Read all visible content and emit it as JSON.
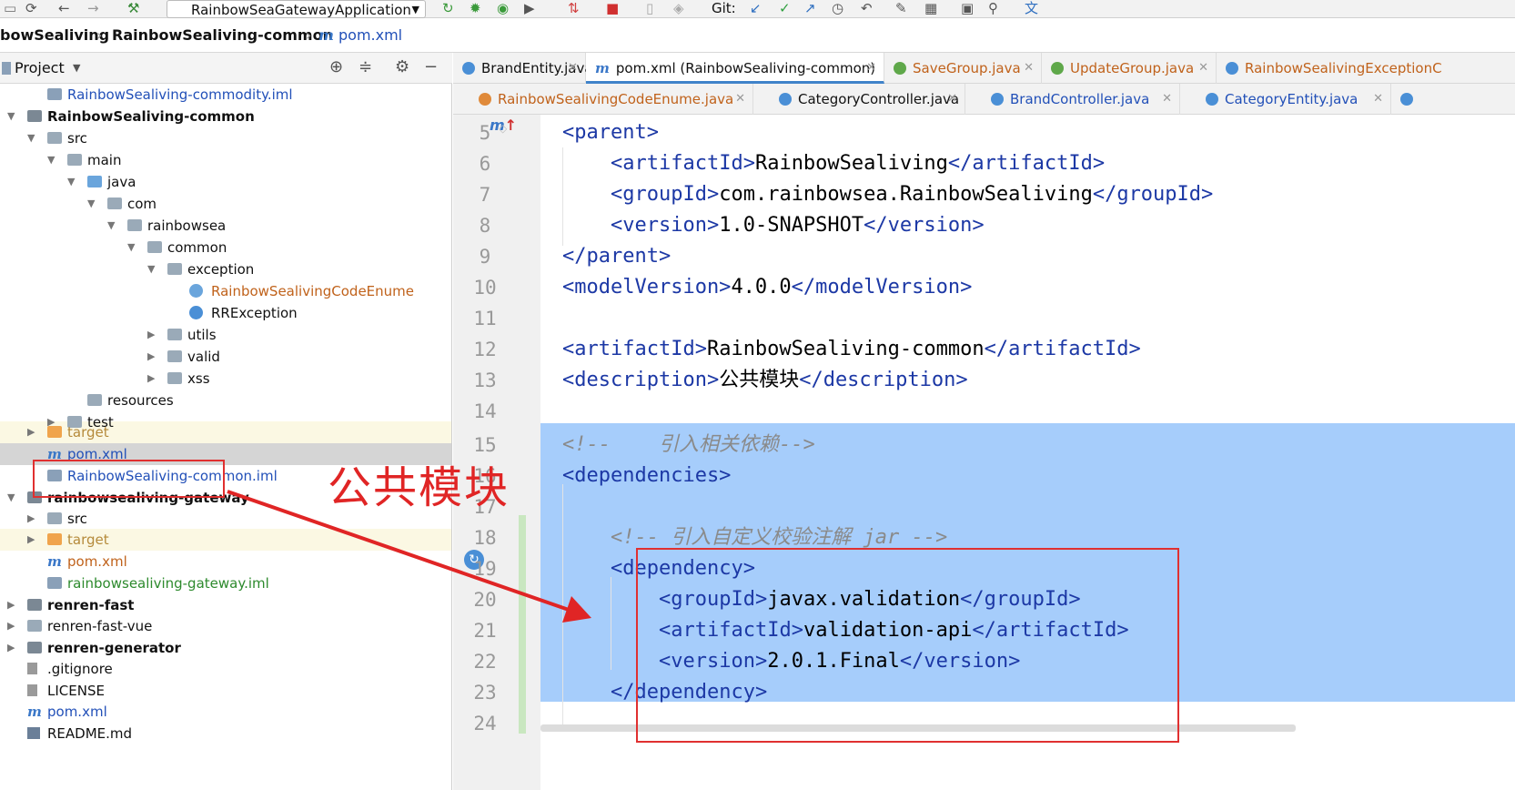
{
  "toolbar": {
    "run_config": "RainbowSeaGatewayApplication",
    "git_label": "Git:"
  },
  "breadcrumb": {
    "items": [
      "bowSealiving",
      "RainbowSealiving-common",
      "pom.xml"
    ]
  },
  "project_panel": {
    "title": "Project",
    "tree": [
      {
        "label": "RainbowSealiving-commodity.iml",
        "color": "#2250b8"
      },
      {
        "label": "RainbowSealiving-common",
        "bold": true
      },
      {
        "label": "src"
      },
      {
        "label": "main"
      },
      {
        "label": "java"
      },
      {
        "label": "com"
      },
      {
        "label": "rainbowsea"
      },
      {
        "label": "common"
      },
      {
        "label": "exception"
      },
      {
        "label": "RainbowSealivingCodeEnume",
        "color": "#c0621b"
      },
      {
        "label": "RRException"
      },
      {
        "label": "utils"
      },
      {
        "label": "valid"
      },
      {
        "label": "xss"
      },
      {
        "label": "resources"
      },
      {
        "label": "test"
      },
      {
        "label": "target",
        "color": "#b58a3a"
      },
      {
        "label": "pom.xml",
        "color": "#2250b8"
      },
      {
        "label": "RainbowSealiving-common.iml",
        "color": "#2250b8"
      },
      {
        "label": "rainbowsealiving-gateway",
        "bold": true
      },
      {
        "label": "src"
      },
      {
        "label": "target",
        "color": "#b58a3a"
      },
      {
        "label": "pom.xml",
        "color": "#c0621b"
      },
      {
        "label": "rainbowsealiving-gateway.iml",
        "color": "#2d8a2d"
      },
      {
        "label": "renren-fast",
        "bold": true
      },
      {
        "label": "renren-fast-vue"
      },
      {
        "label": "renren-generator",
        "bold": true
      },
      {
        "label": ".gitignore"
      },
      {
        "label": "LICENSE"
      },
      {
        "label": "pom.xml",
        "color": "#2250b8"
      },
      {
        "label": "README.md"
      }
    ]
  },
  "tabs_row1": [
    {
      "label": "BrandEntity.java",
      "icon_color": "#4a8fd6"
    },
    {
      "label": "pom.xml (RainbowSealiving-common)",
      "icon_color": "#3a77c8",
      "active": true
    },
    {
      "label": "SaveGroup.java",
      "icon_color": "#5fa84a"
    },
    {
      "label": "UpdateGroup.java",
      "icon_color": "#5fa84a"
    },
    {
      "label": "RainbowSealivingExceptionC",
      "icon_color": "#4a8fd6"
    }
  ],
  "tabs_row2": [
    {
      "label": "RainbowSealivingCodeEnume.java",
      "icon_color": "#e08a3a"
    },
    {
      "label": "CategoryController.java",
      "icon_color": "#4a8fd6"
    },
    {
      "label": "BrandController.java",
      "icon_color": "#4a8fd6"
    },
    {
      "label": "CategoryEntity.java",
      "icon_color": "#4a8fd6"
    }
  ],
  "editor": {
    "lines": [
      {
        "n": "5",
        "parts": [
          [
            "t",
            "<parent>"
          ]
        ]
      },
      {
        "n": "6",
        "parts": [
          [
            "t",
            "<artifactId>"
          ],
          [
            "x",
            "RainbowSealiving"
          ],
          [
            "t",
            "</artifactId>"
          ]
        ]
      },
      {
        "n": "7",
        "parts": [
          [
            "t",
            "<groupId>"
          ],
          [
            "x",
            "com.rainbowsea.RainbowSealiving"
          ],
          [
            "t",
            "</groupId>"
          ]
        ]
      },
      {
        "n": "8",
        "parts": [
          [
            "t",
            "<version>"
          ],
          [
            "x",
            "1.0-SNAPSHOT"
          ],
          [
            "t",
            "</version>"
          ]
        ]
      },
      {
        "n": "9",
        "parts": [
          [
            "t",
            "</parent>"
          ]
        ]
      },
      {
        "n": "10",
        "parts": [
          [
            "t",
            "<modelVersion>"
          ],
          [
            "x",
            "4.0.0"
          ],
          [
            "t",
            "</modelVersion>"
          ]
        ]
      },
      {
        "n": "11",
        "parts": []
      },
      {
        "n": "12",
        "parts": [
          [
            "t",
            "<artifactId>"
          ],
          [
            "x",
            "RainbowSealiving-common"
          ],
          [
            "t",
            "</artifactId>"
          ]
        ]
      },
      {
        "n": "13",
        "parts": [
          [
            "t",
            "<description>"
          ],
          [
            "x",
            "公共模块"
          ],
          [
            "t",
            "</description>"
          ]
        ]
      },
      {
        "n": "14",
        "parts": []
      },
      {
        "n": "15",
        "parts": [
          [
            "c",
            "<!--    引入相关依赖-->"
          ]
        ]
      },
      {
        "n": "16",
        "parts": [
          [
            "t",
            "<dependencies>"
          ]
        ]
      },
      {
        "n": "17",
        "parts": []
      },
      {
        "n": "18",
        "parts": [
          [
            "c",
            "<!-- 引入自定义校验注解 jar -->"
          ]
        ]
      },
      {
        "n": "19",
        "parts": [
          [
            "t",
            "<dependency>"
          ]
        ]
      },
      {
        "n": "20",
        "parts": [
          [
            "t",
            "<groupId>"
          ],
          [
            "x",
            "javax.validation"
          ],
          [
            "t",
            "</groupId>"
          ]
        ]
      },
      {
        "n": "21",
        "parts": [
          [
            "t",
            "<artifactId>"
          ],
          [
            "x",
            "validation-api"
          ],
          [
            "t",
            "</artifactId>"
          ]
        ]
      },
      {
        "n": "22",
        "parts": [
          [
            "t",
            "<version>"
          ],
          [
            "x",
            "2.0.1.Final"
          ],
          [
            "t",
            "</version>"
          ]
        ]
      },
      {
        "n": "23",
        "parts": [
          [
            "t",
            "</dependency>"
          ]
        ]
      },
      {
        "n": "24",
        "parts": []
      }
    ]
  },
  "annotation": {
    "label": "公共模块",
    "color": "#e02525"
  }
}
